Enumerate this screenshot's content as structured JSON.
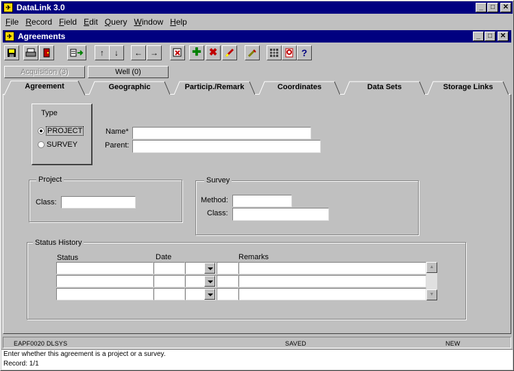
{
  "app": {
    "title": "DataLink 3.0",
    "icon": "datalink-app-icon"
  },
  "menu": [
    "File",
    "Record",
    "Field",
    "Edit",
    "Query",
    "Window",
    "Help"
  ],
  "window": {
    "title": "Agreements"
  },
  "toolbar": {
    "icons": [
      "save-icon",
      "print-icon",
      "exit-door-icon",
      "list-values-icon",
      "arrow-up-icon",
      "arrow-down-icon",
      "arrow-left-icon",
      "arrow-right-icon",
      "enter-query-icon",
      "insert-record-icon",
      "delete-record-icon",
      "clear-icon",
      "edit-icon",
      "grid-icon",
      "lookup-icon",
      "help-icon"
    ]
  },
  "subtabs": [
    {
      "label": "Acquisition (3)",
      "enabled": false
    },
    {
      "label": "Well (0)",
      "enabled": true
    }
  ],
  "tabs": [
    "Agreement",
    "Geographic",
    "Particip./Remark",
    "Coordinates",
    "Data Sets",
    "Storage Links"
  ],
  "type_group": {
    "label": "Type",
    "options": [
      "PROJECT",
      "SURVEY"
    ],
    "selected": "PROJECT"
  },
  "name_label": "Name*",
  "parent_label": "Parent:",
  "project_group": {
    "label": "Project",
    "class_label": "Class:"
  },
  "survey_group": {
    "label": "Survey",
    "method_label": "Method:",
    "class_label": "Class:"
  },
  "status_history": {
    "label": "Status History",
    "columns": [
      "Status",
      "Date",
      "Remarks"
    ],
    "rows": 3
  },
  "statusbar": {
    "left": "EAPF0020 DLSYS",
    "center": "SAVED",
    "right": "NEW"
  },
  "hint": "Enter whether this agreement is a project or a survey.",
  "record": "Record: 1/1"
}
